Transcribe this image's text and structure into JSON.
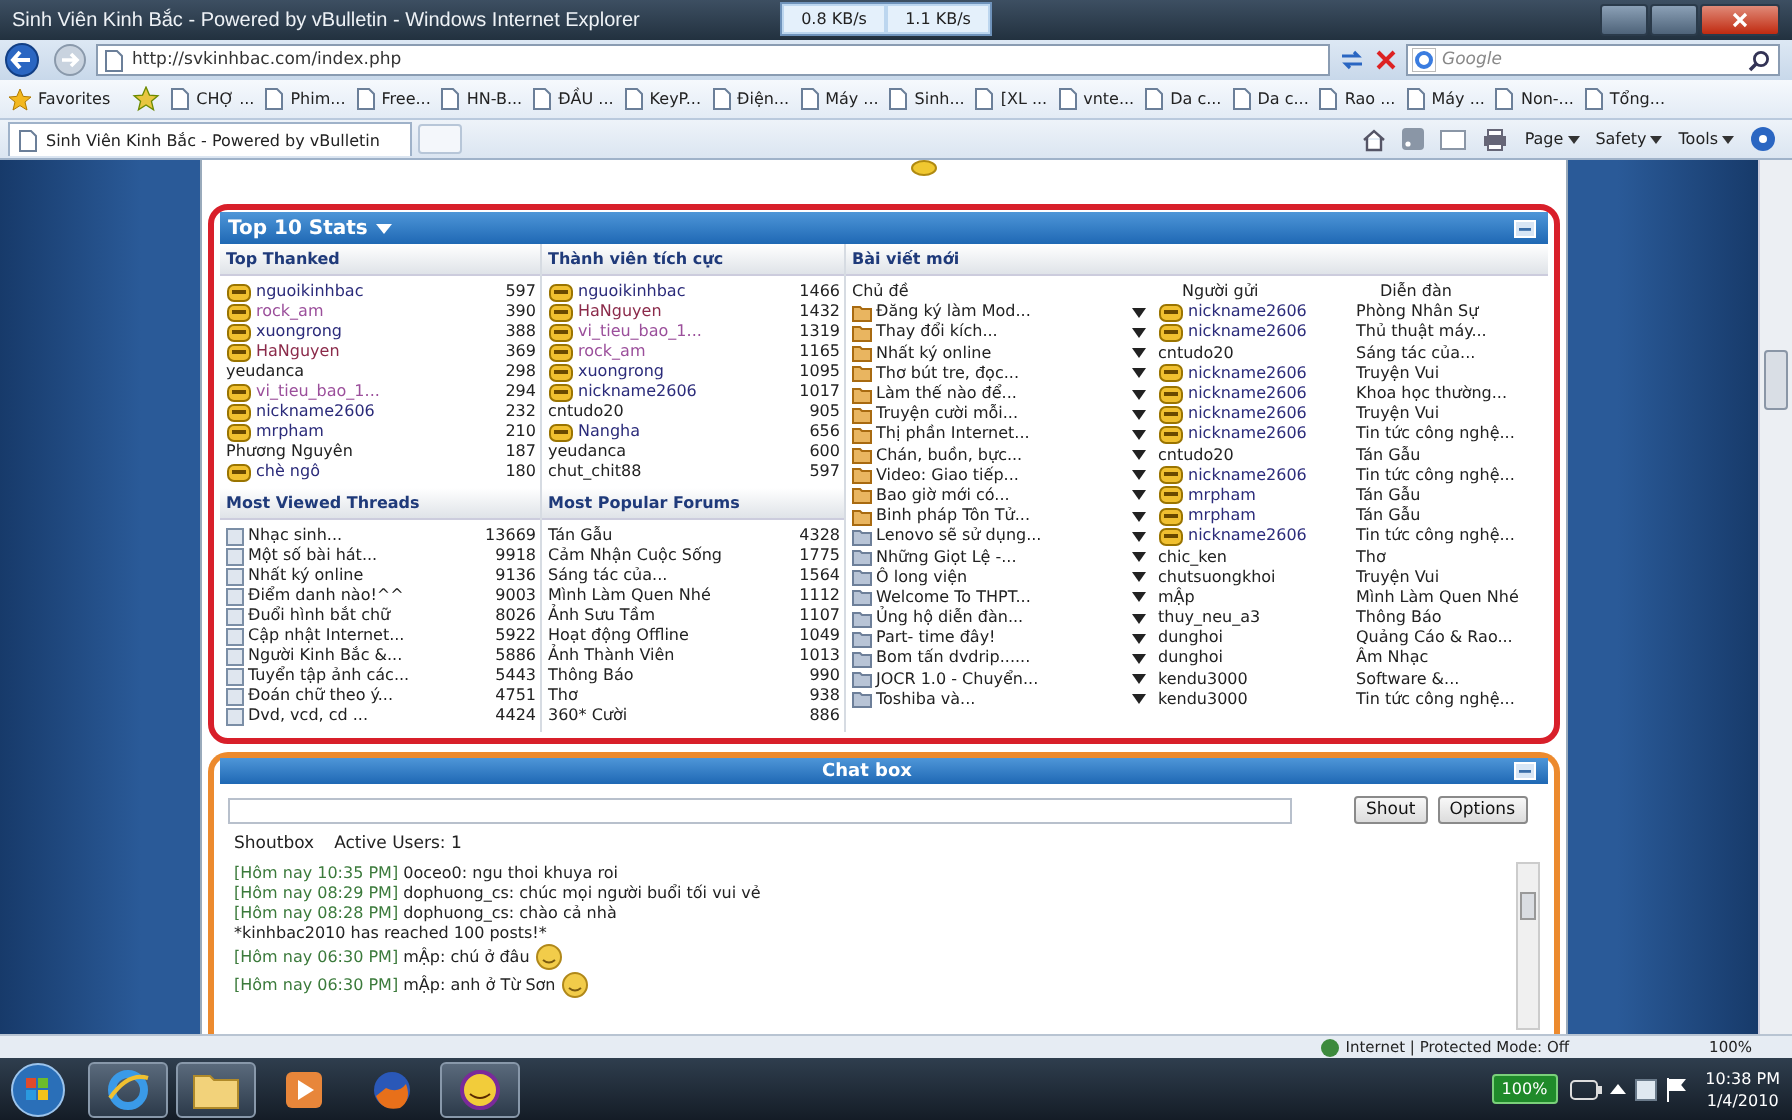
{
  "window": {
    "title": "Sinh Viên Kinh Bắc - Powered by vBulletin - Windows Internet Explorer",
    "speeds": [
      "0.8 KB/s",
      "1.1 KB/s"
    ]
  },
  "address_bar": {
    "url": "http://svkinhbac.com/index.php",
    "search": {
      "placeholder": "Google"
    }
  },
  "favorites_bar": {
    "label": "Favorites",
    "items": [
      "CHỢ ...",
      "Phim...",
      "Free...",
      "HN-B...",
      "ĐẦU ...",
      "KeyP...",
      "Điện...",
      "Máy ...",
      "Sinh...",
      "[XL ...",
      "vnte...",
      "Da c...",
      "Da c...",
      "Rao ...",
      "Máy ...",
      "Non-...",
      "Tổng..."
    ]
  },
  "tab": {
    "title": "Sinh Viên Kinh Bắc - Powered by vBulletin"
  },
  "command_bar": [
    "Page",
    "Safety",
    "Tools"
  ],
  "stats": {
    "title": "Top 10 Stats",
    "top_thanked": {
      "title": "Top Thanked",
      "rows": [
        {
          "name": "nguoikinhbac",
          "count": "597",
          "avatar": true,
          "color": "#2b2b7a"
        },
        {
          "name": "rock_am",
          "count": "390",
          "avatar": true,
          "color": "#9b4f9b"
        },
        {
          "name": "xuongrong",
          "count": "388",
          "avatar": true,
          "color": "#2b2b7a"
        },
        {
          "name": "HaNguyen",
          "count": "369",
          "avatar": true,
          "color": "#8b2a4a"
        },
        {
          "name": "yeudanca",
          "count": "298",
          "avatar": false,
          "color": "#222222"
        },
        {
          "name": "vi_tieu_bao_1...",
          "count": "294",
          "avatar": true,
          "color": "#9b4f9b"
        },
        {
          "name": "nickname2606",
          "count": "232",
          "avatar": true,
          "color": "#2b2b7a"
        },
        {
          "name": "mrpham",
          "count": "210",
          "avatar": true,
          "color": "#2b2b7a"
        },
        {
          "name": "Phương Nguyên",
          "count": "187",
          "avatar": false,
          "color": "#222222"
        },
        {
          "name": "chè ngô",
          "count": "180",
          "avatar": true,
          "color": "#2b2b7a"
        }
      ]
    },
    "active_members": {
      "title": "Thành viên tích cực",
      "rows": [
        {
          "name": "nguoikinhbac",
          "count": "1466",
          "avatar": true,
          "color": "#2b2b7a"
        },
        {
          "name": "HaNguyen",
          "count": "1432",
          "avatar": true,
          "color": "#8b2a4a"
        },
        {
          "name": "vi_tieu_bao_1...",
          "count": "1319",
          "avatar": true,
          "color": "#9b4f9b"
        },
        {
          "name": "rock_am",
          "count": "1165",
          "avatar": true,
          "color": "#9b4f9b"
        },
        {
          "name": "xuongrong",
          "count": "1095",
          "avatar": true,
          "color": "#2b2b7a"
        },
        {
          "name": "nickname2606",
          "count": "1017",
          "avatar": true,
          "color": "#2b2b7a"
        },
        {
          "name": "cntudo20",
          "count": "905",
          "avatar": false,
          "color": "#222222"
        },
        {
          "name": "Nangha",
          "count": "656",
          "avatar": true,
          "color": "#2b2b7a"
        },
        {
          "name": "yeudanca",
          "count": "600",
          "avatar": false,
          "color": "#222222"
        },
        {
          "name": "chut_chit88",
          "count": "597",
          "avatar": false,
          "color": "#222222"
        }
      ]
    },
    "most_viewed": {
      "title": "Most Viewed Threads",
      "rows": [
        {
          "name": "Nhạc sinh...",
          "count": "13669"
        },
        {
          "name": "Một số bài hát...",
          "count": "9918"
        },
        {
          "name": "Nhất ký online",
          "count": "9136"
        },
        {
          "name": "Điểm danh nào!^^",
          "count": "9003"
        },
        {
          "name": "Đuổi hình bắt chữ",
          "count": "8026"
        },
        {
          "name": "Cập nhật Internet...",
          "count": "5922"
        },
        {
          "name": "Người Kinh Bắc &...",
          "count": "5886"
        },
        {
          "name": "Tuyển tập ảnh các...",
          "count": "5443"
        },
        {
          "name": "Đoán chữ theo ý...",
          "count": "4751"
        },
        {
          "name": "Dvd, vcd, cd ...",
          "count": "4424"
        }
      ]
    },
    "popular_forums": {
      "title": "Most Popular Forums",
      "rows": [
        {
          "name": "Tán Gẫu",
          "count": "4328"
        },
        {
          "name": "Cảm Nhận Cuộc Sống",
          "count": "1775"
        },
        {
          "name": "Sáng tác của...",
          "count": "1564"
        },
        {
          "name": "Mình Làm Quen Nhé",
          "count": "1112"
        },
        {
          "name": "Ảnh Sưu Tầm",
          "count": "1107"
        },
        {
          "name": "Hoạt động Offline",
          "count": "1049"
        },
        {
          "name": "Ảnh Thành Viên",
          "count": "1013"
        },
        {
          "name": "Thông Báo",
          "count": "990"
        },
        {
          "name": "Thơ",
          "count": "938"
        },
        {
          "name": "360* Cười",
          "count": "886"
        }
      ]
    },
    "new_posts": {
      "title": "Bài viết mới",
      "columns": [
        "Chủ đề",
        "Người gửi",
        "Diễn đàn"
      ],
      "rows": [
        {
          "topic": "Đăng ký làm Mod...",
          "unread": true,
          "poster": "nickname2606",
          "avatar": true,
          "forum": "Phòng Nhân Sự"
        },
        {
          "topic": "Thay đổi kích...",
          "unread": true,
          "poster": "nickname2606",
          "avatar": true,
          "forum": "Thủ thuật máy..."
        },
        {
          "topic": "Nhất ký online",
          "unread": true,
          "poster": "cntudo20",
          "avatar": false,
          "forum": "Sáng tác của..."
        },
        {
          "topic": "Thơ bút tre, đọc...",
          "unread": true,
          "poster": "nickname2606",
          "avatar": true,
          "forum": "Truyện Vui"
        },
        {
          "topic": "Làm thế nào để...",
          "unread": true,
          "poster": "nickname2606",
          "avatar": true,
          "forum": "Khoa học thường..."
        },
        {
          "topic": "Truyện cười mỗi...",
          "unread": true,
          "poster": "nickname2606",
          "avatar": true,
          "forum": "Truyện Vui"
        },
        {
          "topic": "Thị phần Internet...",
          "unread": true,
          "poster": "nickname2606",
          "avatar": true,
          "forum": "Tin tức công nghệ..."
        },
        {
          "topic": "Chán, buồn, bực...",
          "unread": true,
          "poster": "cntudo20",
          "avatar": false,
          "forum": "Tán Gẫu"
        },
        {
          "topic": "Video: Giao tiếp...",
          "unread": true,
          "poster": "nickname2606",
          "avatar": true,
          "forum": "Tin tức công nghệ..."
        },
        {
          "topic": "Bao giờ mới có...",
          "unread": true,
          "poster": "mrpham",
          "avatar": true,
          "forum": "Tán Gẫu"
        },
        {
          "topic": "Binh pháp Tôn Tử...",
          "unread": true,
          "poster": "mrpham",
          "avatar": true,
          "forum": "Tán Gẫu"
        },
        {
          "topic": "Lenovo sẽ sử dụng...",
          "unread": false,
          "poster": "nickname2606",
          "avatar": true,
          "forum": "Tin tức công nghệ..."
        },
        {
          "topic": "Những Giọt Lệ -...",
          "unread": false,
          "poster": "chic_ken",
          "avatar": false,
          "forum": "Thơ"
        },
        {
          "topic": "Ô long viện",
          "unread": false,
          "poster": "chutsuongkhoi",
          "avatar": false,
          "forum": "Truyện Vui"
        },
        {
          "topic": "Welcome To THPT...",
          "unread": false,
          "poster": "mẬp",
          "avatar": false,
          "forum": "Mình Làm Quen Nhé"
        },
        {
          "topic": "Ủng hộ diễn đàn...",
          "unread": false,
          "poster": "thuy_neu_a3",
          "avatar": false,
          "forum": "Thông Báo"
        },
        {
          "topic": "Part- time đây!",
          "unread": false,
          "poster": "dunghoi",
          "avatar": false,
          "forum": "Quảng Cáo & Rao..."
        },
        {
          "topic": "Bom tấn dvdrip......",
          "unread": false,
          "poster": "dunghoi",
          "avatar": false,
          "forum": "Âm Nhạc"
        },
        {
          "topic": "JOCR 1.0 - Chuyển...",
          "unread": false,
          "poster": "kendu3000",
          "avatar": false,
          "forum": "Software &..."
        },
        {
          "topic": "Toshiba và...",
          "unread": false,
          "poster": "kendu3000",
          "avatar": false,
          "forum": "Tin tức công nghệ..."
        }
      ]
    }
  },
  "chat": {
    "title": "Chat box",
    "buttons": [
      "Shout",
      "Options"
    ],
    "tabs": [
      "Shoutbox",
      "Active Users: 1"
    ],
    "messages": [
      {
        "kind": "message",
        "time": "[Hôm nay 10:35 PM]",
        "text": "0oceo0: ngu thoi khuya roi",
        "emoticon": false
      },
      {
        "kind": "message",
        "time": "[Hôm nay 08:29 PM]",
        "text": "dophuong_cs: chúc mọi người buổi tối vui vẻ",
        "emoticon": false
      },
      {
        "kind": "message",
        "time": "[Hôm nay 08:28 PM]",
        "text": "dophuong_cs: chào cả nhà",
        "emoticon": false
      },
      {
        "kind": "notice",
        "text": "*kinhbac2010 has reached 100 posts!*",
        "emoticon": false
      },
      {
        "kind": "message",
        "time": "[Hôm nay 06:30 PM]",
        "text": "mẬp: chú ở đâu",
        "emoticon": true
      },
      {
        "kind": "message",
        "time": "[Hôm nay 06:30 PM]",
        "text": "mẬp: anh ở Từ Sơn",
        "emoticon": true
      }
    ]
  },
  "status_bar": {
    "zone": "Internet | Protected Mode: Off",
    "zoom": "100%"
  },
  "taskbar": {
    "apps": [
      {
        "kind": "browser",
        "running": true
      },
      {
        "kind": "folder",
        "running": true
      },
      {
        "kind": "media",
        "running": false
      },
      {
        "kind": "fox",
        "running": false
      },
      {
        "kind": "messenger",
        "running": true
      }
    ],
    "battery": "100%",
    "time": "10:38 PM",
    "date": "1/4/2010"
  }
}
